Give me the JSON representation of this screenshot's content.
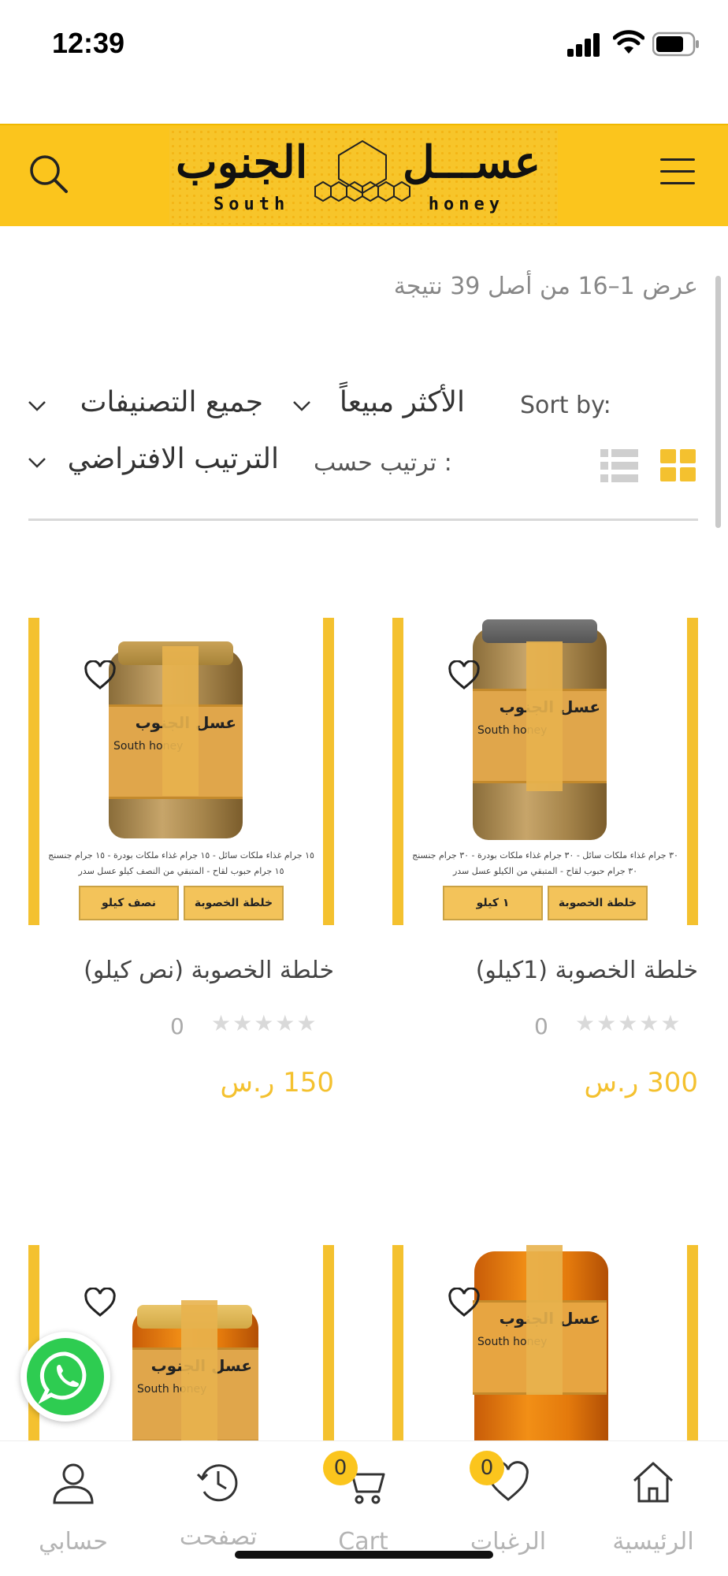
{
  "status_bar": {
    "time": "12:39"
  },
  "header": {
    "logo": {
      "ar_right": "عســـل",
      "ar_left": "الجنوب",
      "en_left": "South",
      "en_right": "honey"
    }
  },
  "results": {
    "count_text": "عرض 1–16 من أصل 39 نتيجة"
  },
  "filters": {
    "sort_by_label": "Sort by:",
    "bestselling": "الأكثر مبيعاً",
    "categories": "جميع التصنيفات",
    "sort_label_ar": "ترتيب حسب :",
    "sort_selected": "الترتيب الافتراضي"
  },
  "products": [
    {
      "title": "خلطة الخصوبة (1كيلو)",
      "rating_count": "0",
      "price": "300 ر.س",
      "image_caption": "٣٠ جرام غذاء ملكات سائل - ٣٠ جرام غذاء ملكات بودرة - ٣٠ جرام جنسنج ٣٠ جرام حبوب لقاح - المتبقي من الكيلو عسل سدر",
      "image_badges": [
        "خلطة الخصوبة",
        "١ كيلو"
      ],
      "jar_label_ar": "عسل الجنوب",
      "jar_label_en": "South  honey"
    },
    {
      "title": "خلطة الخصوبة (نص كيلو)",
      "rating_count": "0",
      "price": "150 ر.س",
      "image_caption": "١٥ جرام غذاء ملكات سائل - ١٥ جرام غذاء ملكات بودرة - ١٥ جرام جنسنج ١٥ جرام حبوب لقاح - المتبقي من النصف كيلو عسل سدر",
      "image_badges": [
        "خلطة الخصوبة",
        "نصف كيلو"
      ],
      "jar_label_ar": "عسل الجنوب",
      "jar_label_en": "South  honey"
    },
    {
      "jar_label_ar": "عسل الجنوب",
      "jar_label_en": "South  honey"
    },
    {
      "jar_label_ar": "عسل الجنوب",
      "jar_label_en": "South  honey"
    }
  ],
  "bottom_nav": {
    "home": "الرئيسية",
    "wishlist": "الرغبات",
    "wishlist_badge": "0",
    "cart": "Cart",
    "cart_badge": "0",
    "browsed": "تصفحت",
    "account": "حسابي"
  },
  "colors": {
    "accent": "#fbc51d",
    "price": "#f4c12f",
    "whatsapp": "#2ecc51"
  }
}
